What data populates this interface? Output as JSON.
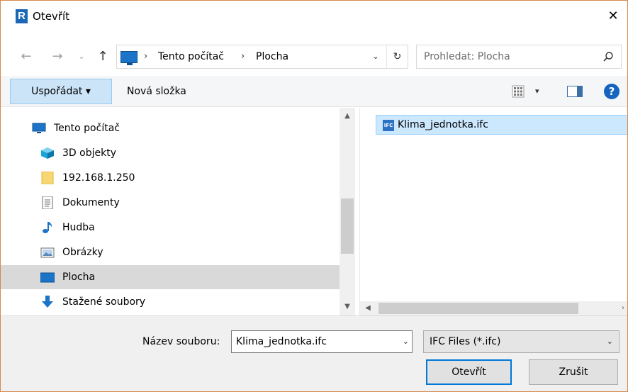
{
  "window": {
    "title": "Otevřít",
    "app_icon_letter": "R",
    "close_glyph": "✕"
  },
  "address_bar": {
    "back_glyph": "←",
    "forward_glyph": "→",
    "recent_glyph": "⌄",
    "up_glyph": "↑",
    "separator": "›",
    "crumbs": [
      "Tento počítač",
      "Plocha"
    ],
    "dropdown_glyph": "⌄",
    "refresh_glyph": "↻"
  },
  "search": {
    "placeholder": "Prohledat: Plocha"
  },
  "toolbar": {
    "organize_label": "Uspořádat ▾",
    "new_folder_label": "Nová složka",
    "view_dropdown_glyph": "▾",
    "help_glyph": "?"
  },
  "navigation": {
    "items": [
      {
        "label": "Tento počítač",
        "icon": "computer-icon"
      },
      {
        "label": "3D objekty",
        "icon": "3d-objects-icon"
      },
      {
        "label": "192.168.1.250",
        "icon": "folder-icon"
      },
      {
        "label": "Dokumenty",
        "icon": "documents-icon"
      },
      {
        "label": "Hudba",
        "icon": "music-icon"
      },
      {
        "label": "Obrázky",
        "icon": "pictures-icon"
      },
      {
        "label": "Plocha",
        "icon": "desktop-icon",
        "selected": true
      },
      {
        "label": "Stažené soubory",
        "icon": "downloads-icon"
      }
    ],
    "scroll_up_glyph": "▲",
    "scroll_down_glyph": "▼"
  },
  "file_list": {
    "items": [
      {
        "name": "Klima_jednotka.ifc",
        "icon": "ifc-file-icon",
        "icon_text": "IFC",
        "selected": true
      }
    ],
    "scroll_left_glyph": "◀",
    "scroll_right_glyph": "›"
  },
  "footer": {
    "filename_label": "Název souboru:",
    "filename_value": "Klima_jednotka.ifc",
    "filename_dropdown_glyph": "⌄",
    "filetype_value": "IFC Files (*.ifc)",
    "filetype_dropdown_glyph": "⌄",
    "open_label": "Otevřít",
    "cancel_label": "Zrušit"
  },
  "colors": {
    "accent": "#0078d7",
    "selection": "#cce8ff",
    "nav_selected": "#d9d9d9",
    "organize_button": "#cce4f7",
    "window_border": "#d48a4a"
  }
}
